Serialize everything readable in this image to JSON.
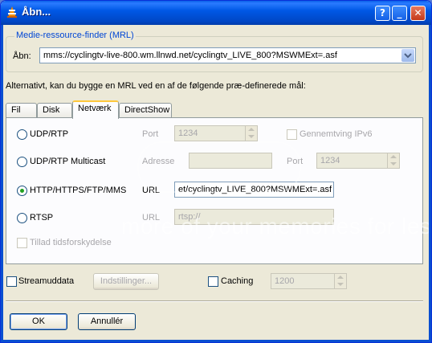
{
  "window": {
    "title": "Åbn..."
  },
  "titlebar_buttons": {
    "help": "?",
    "minimize": "_",
    "close": "✕"
  },
  "mrl_group": {
    "label": "Medie-ressource-finder (MRL)",
    "open_label": "Åbn:",
    "open_value": "mms://cyclingtv-live-800.wm.llnwd.net/cyclingtv_LIVE_800?MSWMExt=.asf"
  },
  "alt_text": "Alternativt, kan du bygge en MRL ved en af de følgende præ-definerede mål:",
  "tabs": [
    {
      "label": "Fil"
    },
    {
      "label": "Disk"
    },
    {
      "label": "Netværk",
      "active": true
    },
    {
      "label": "DirectShow"
    }
  ],
  "network": {
    "udp_rtp": {
      "label": "UDP/RTP",
      "port_label": "Port",
      "port_value": "1234",
      "ipv6_label": "Gennemtving IPv6"
    },
    "udp_multicast": {
      "label": "UDP/RTP Multicast",
      "address_label": "Adresse",
      "address_value": "",
      "port_label": "Port",
      "port_value": "1234"
    },
    "http": {
      "label": "HTTP/HTTPS/FTP/MMS",
      "url_label": "URL",
      "url_value": "et/cyclingtv_LIVE_800?MSWMExt=.asf",
      "selected": true
    },
    "rtsp": {
      "label": "RTSP",
      "url_label": "URL",
      "url_value": "rtsp://"
    },
    "timeshift_label": "Tillad tidsforskydelse"
  },
  "bottom": {
    "stream_label": "Streamuddata",
    "settings_label": "Indstillinger...",
    "caching_label": "Caching",
    "caching_value": "1200"
  },
  "buttons": {
    "ok": "OK",
    "cancel": "Annullér"
  },
  "watermark": {
    "text": "more of your memories for less!"
  },
  "colors": {
    "titlebar": "#0058e6",
    "group_label": "#0046d5",
    "window_bg": "#ece9d8",
    "radio_dot": "#21a121"
  }
}
